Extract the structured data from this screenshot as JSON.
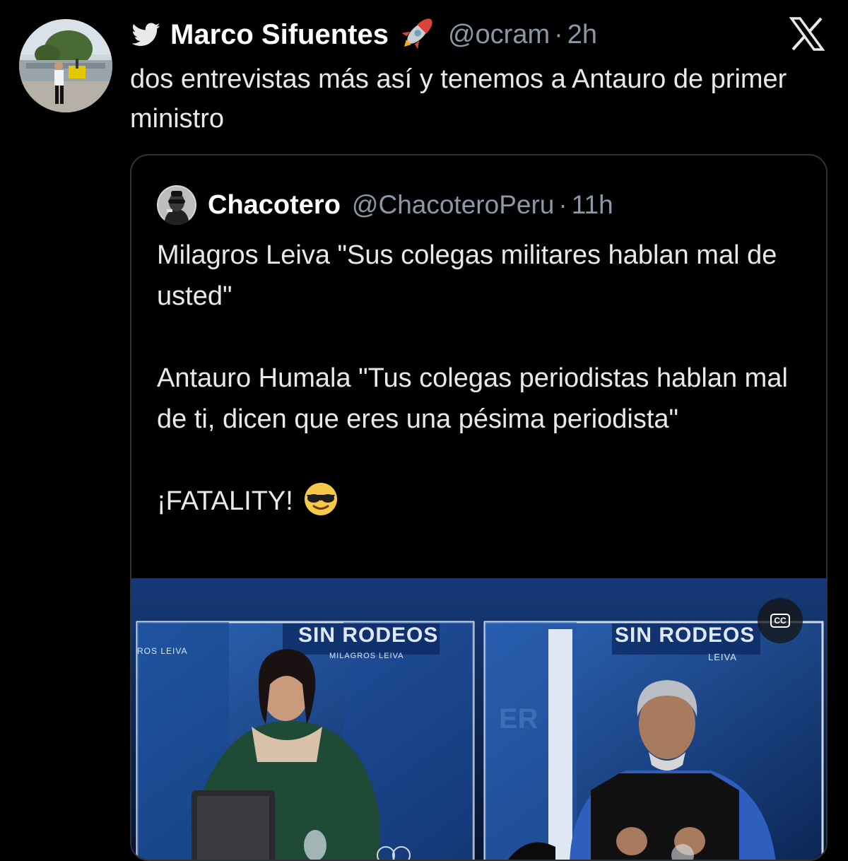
{
  "tweet": {
    "author_name": "Marco Sifuentes",
    "author_emoji": "🚀",
    "handle": "@ocram",
    "separator": "·",
    "time": "2h",
    "text": "dos entrevistas más así y tenemos a Antauro de primer ministro"
  },
  "quoted": {
    "author_name": "Chacotero",
    "handle": "@ChacoteroPeru",
    "separator": "·",
    "time": "11h",
    "paragraphs": [
      "Milagros Leiva \"Sus colegas militares hablan mal de usted\"",
      "Antauro Humala \"Tus colegas periodistas hablan mal de ti, dicen que eres una pésima periodista\"",
      "¡FATALITY!"
    ],
    "emoji": "😎",
    "media": {
      "left_screen_title": "SIN RODEOS",
      "left_screen_subtitle": "MILAGROS LEIVA",
      "left_edge_text": "ROS LEIVA",
      "right_screen_title": "SIN RODEOS",
      "right_screen_subtitle": "LEIVA",
      "cc_label": "CC"
    }
  },
  "icons": {
    "twitter_bird": "twitter-bird-icon",
    "close": "x-logo-icon",
    "cc": "closed-captions-icon"
  },
  "colors": {
    "background": "#000000",
    "text": "#e7e9ea",
    "muted": "#8b98a5",
    "border": "#2f3336"
  }
}
